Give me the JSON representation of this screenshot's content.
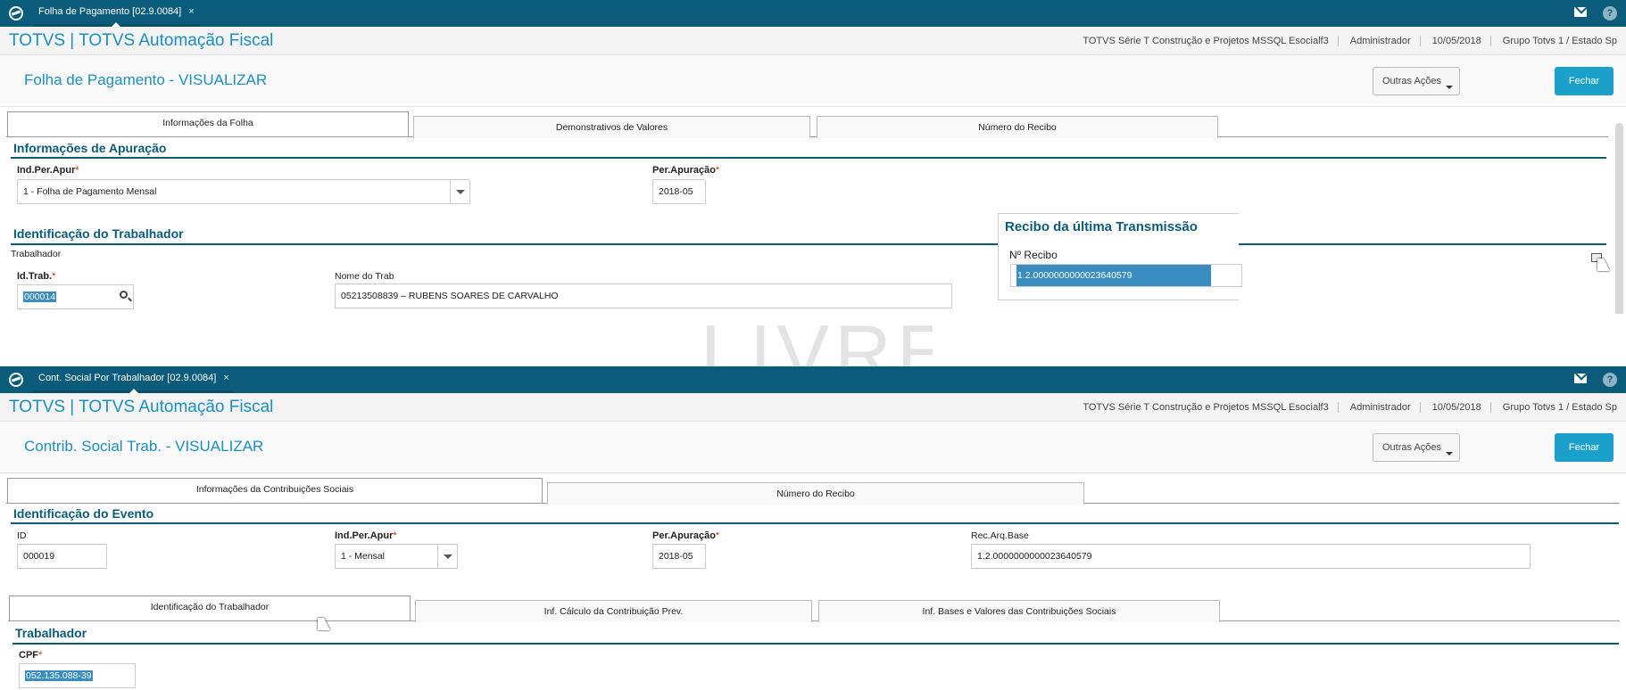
{
  "w1": {
    "tab_label": "Folha de Pagamento [02.9.0084]",
    "tab_close": "×",
    "app_title": "TOTVS | TOTVS Automação Fiscal",
    "header_info": {
      "company": "TOTVS Série T Construção e Projetos MSSQL Esocialf3",
      "user": "Administrador",
      "date": "10/05/2018",
      "group": "Grupo Totvs 1 / Estado Sp"
    },
    "page_title": "Folha de Pagamento - VISUALIZAR",
    "btn_outras": "Outras Ações",
    "btn_fechar": "Fechar",
    "tabs": [
      "Informações da Folha",
      "Demonstrativos de Valores",
      "Número do Recibo"
    ],
    "section1": "Informações de Apuração",
    "ind_per_apur_label": "Ind.Per.Apur",
    "ind_per_apur_value": "1 - Folha de Pagamento Mensal",
    "per_apuracao_label": "Per.Apuração",
    "per_apuracao_value": "2018-05",
    "section2": "Identificação do Trabalhador",
    "trabalhador_label": "Trabalhador",
    "id_trab_label": "Id.Trab.",
    "id_trab_value": "000014",
    "nome_trab_label": "Nome do Trab",
    "nome_trab_value": "05213508839 – RUBENS SOARES DE CARVALHO",
    "recibo_title": "Recibo da última Transmissão",
    "recibo_label": "Nº Recibo",
    "recibo_value": "1.2.0000000000023640579",
    "required_mark": "*"
  },
  "watermark": "LIVRE",
  "w2": {
    "tab_label": "Cont. Social Por Trabalhador [02.9.0084]",
    "tab_close": "×",
    "app_title": "TOTVS | TOTVS Automação Fiscal",
    "header_info": {
      "company": "TOTVS Série T Construção e Projetos MSSQL Esocialf3",
      "user": "Administrador",
      "date": "10/05/2018",
      "group": "Grupo Totvs 1 / Estado Sp"
    },
    "page_title": "Contrib. Social Trab. - VISUALIZAR",
    "btn_outras": "Outras Ações",
    "btn_fechar": "Fechar",
    "tabs": [
      "Informações da Contribuições Sociais",
      "Número do Recibo"
    ],
    "section1": "Identificação do Evento",
    "id_label": "ID",
    "id_value": "000019",
    "ind_per_apur_label": "Ind.Per.Apur",
    "ind_per_apur_value": "1 - Mensal",
    "per_apuracao_label": "Per.Apuração",
    "per_apuracao_value": "2018-05",
    "rec_arq_label": "Rec.Arq.Base",
    "rec_arq_value": "1.2.0000000000023640579",
    "subtabs": [
      "Identificação do Trabalhador",
      "Inf. Cálculo da Contribuição Prev.",
      "Inf. Bases e Valores das Contribuições Sociais"
    ],
    "section2": "Trabalhador",
    "cpf_label": "CPF",
    "cpf_value": "052.135.088-39",
    "required_mark": "*"
  },
  "colors": {
    "titlebar": "#0b5c7a",
    "accent": "#1ba0cc",
    "section": "#0b5c7a",
    "required": "#d11"
  },
  "icons": [
    "totvs-logo-icon",
    "mail-icon",
    "help-icon",
    "search-icon",
    "dropdown-arrow-icon",
    "print-icon",
    "mouse-cursor-icon"
  ]
}
